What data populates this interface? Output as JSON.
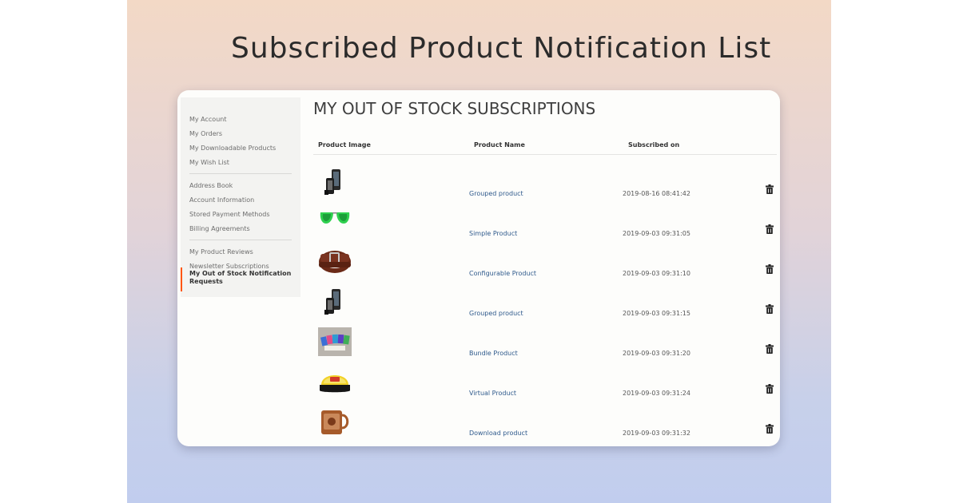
{
  "banner": {
    "headline": "Subscribed Product Notification List"
  },
  "sidebar": {
    "groups": [
      [
        "My Account",
        "My Orders",
        "My Downloadable Products",
        "My Wish List"
      ],
      [
        "Address Book",
        "Account Information",
        "Stored Payment Methods",
        "Billing Agreements"
      ],
      [
        "My Product Reviews",
        "Newsletter Subscriptions"
      ]
    ],
    "active_item": "My Out of Stock Notification Requests"
  },
  "page": {
    "title": "MY OUT OF STOCK SUBSCRIPTIONS"
  },
  "table": {
    "headers": {
      "image": "Product Image",
      "name": "Product Name",
      "subscribed": "Subscribed on"
    },
    "rows": [
      {
        "name": "Grouped product",
        "date": "2019-08-16 08:41:42",
        "image_icon": "phone-set-icon"
      },
      {
        "name": "Simple Product",
        "date": "2019-09-03 09:31:05",
        "image_icon": "sunglasses-icon"
      },
      {
        "name": "Configurable Product",
        "date": "2019-09-03 09:31:10",
        "image_icon": "belt-icon"
      },
      {
        "name": "Grouped product",
        "date": "2019-09-03 09:31:15",
        "image_icon": "phone-set-icon"
      },
      {
        "name": "Bundle Product",
        "date": "2019-09-03 09:31:20",
        "image_icon": "card-bundle-icon"
      },
      {
        "name": "Virtual Product",
        "date": "2019-09-03 09:31:24",
        "image_icon": "cap-icon"
      },
      {
        "name": "Download product",
        "date": "2019-09-03 09:31:32",
        "image_icon": "mug-icon"
      }
    ],
    "delete_icon": "trash-icon"
  },
  "colors": {
    "accent": "#ff5501",
    "link": "#2f5a8c",
    "banner_top": "#f3d9c6",
    "banner_bottom": "#c1cdee"
  }
}
